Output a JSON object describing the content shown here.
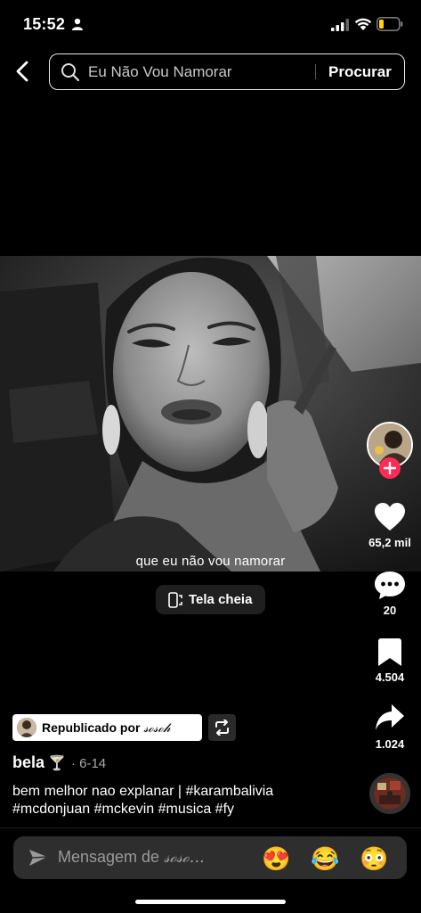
{
  "status_bar": {
    "time": "15:52"
  },
  "search": {
    "query": "Eu Não Vou Namorar",
    "submit_label": "Procurar"
  },
  "video": {
    "subtitle": "que eu não vou namorar",
    "fullscreen_label": "Tela cheia"
  },
  "actions": {
    "likes": "65,2 mil",
    "comments": "20",
    "saves": "4.504",
    "shares": "1.024"
  },
  "repost": {
    "label": "Republicado por",
    "user": "𝓈ℴ𝓈ℴ𝒽"
  },
  "post": {
    "author": "bela",
    "author_emoji": "🍸",
    "date": "· 6-14",
    "caption": "bem melhor nao explanar | #karambalivia #mcdonjuan #mckevin #musica #fy"
  },
  "comment_bar": {
    "placeholder_prefix": "Mensagem de",
    "placeholder_user": "𝓈ℴ𝓈ℴ...",
    "emojis": [
      "😍",
      "😂",
      "😳"
    ]
  },
  "colors": {
    "accent": "#fe2c55",
    "background": "#000000"
  },
  "icons": [
    "person-icon",
    "signal-icon",
    "wifi-icon",
    "battery-icon",
    "back-icon",
    "search-icon",
    "fullscreen-icon",
    "plus-icon",
    "heart-icon",
    "comment-icon",
    "bookmark-icon",
    "share-icon",
    "repost-icon",
    "send-icon"
  ]
}
